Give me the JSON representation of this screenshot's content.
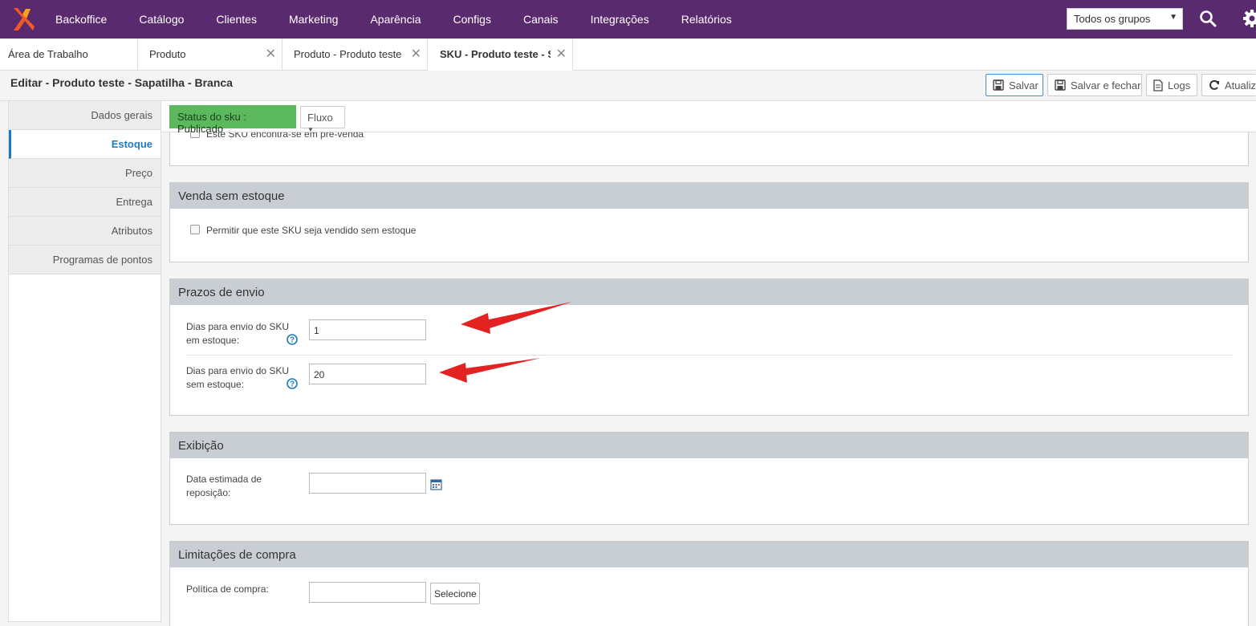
{
  "topnav": {
    "items": [
      "Backoffice",
      "Catálogo",
      "Clientes",
      "Marketing",
      "Aparência",
      "Configs",
      "Canais",
      "Integrações",
      "Relatórios"
    ],
    "group_select": "Todos os grupos",
    "logo_icon": "brand-logo-icon",
    "bg_color": "#5a2a6e"
  },
  "tabs": [
    {
      "label": "Área de Trabalho",
      "closable": false
    },
    {
      "label": "Produto",
      "closable": true
    },
    {
      "label": "Produto - Produto teste - Sapatilha",
      "closable": true
    },
    {
      "label": "SKU - Produto teste - Sapatilha",
      "closable": true,
      "active": true
    }
  ],
  "header": {
    "title": "Editar - Produto teste - Sapatilha - Branca",
    "buttons": {
      "save": "Salvar",
      "save_close": "Salvar e fechar",
      "logs": "Logs",
      "refresh": "Atualizar"
    }
  },
  "sidebar": {
    "items": [
      "Dados gerais",
      "Estoque",
      "Preço",
      "Entrega",
      "Atributos",
      "Programas de pontos"
    ],
    "active": "Estoque"
  },
  "status": {
    "badge": "Status do sku : Publicado",
    "fluxo": "Fluxo"
  },
  "presale": {
    "label": "Este SKU encontra-se em pré-venda"
  },
  "venda_sem_estoque": {
    "title": "Venda sem estoque",
    "checkbox_label": "Permitir que este SKU seja vendido sem estoque"
  },
  "prazos": {
    "title": "Prazos de envio",
    "in_stock_label_1": "Dias para envio do SKU",
    "in_stock_label_2": "em estoque:",
    "in_stock_value": "1",
    "out_stock_label_1": "Dias para envio do SKU",
    "out_stock_label_2": "sem estoque:",
    "out_stock_value": "20"
  },
  "exibicao": {
    "title": "Exibição",
    "date_label_1": "Data estimada de",
    "date_label_2": "reposição:",
    "date_value": ""
  },
  "limitacoes": {
    "title": "Limitações de compra",
    "policy_label": "Política de compra:",
    "policy_value": "",
    "select_button": "Selecione"
  }
}
